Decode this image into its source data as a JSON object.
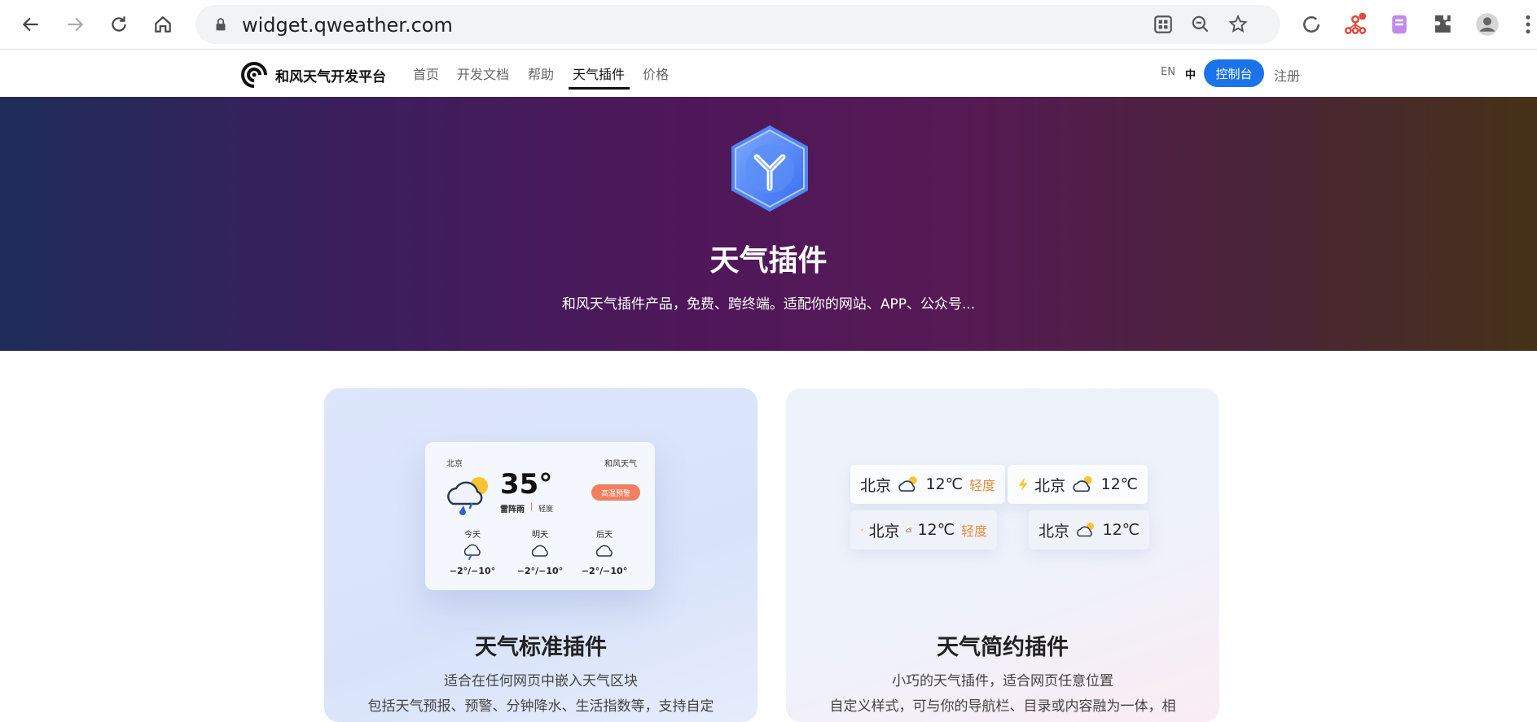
{
  "browser": {
    "url": "widget.qweather.com"
  },
  "site": {
    "brand": "和风天气开发平台",
    "menu": [
      "首页",
      "开发文档",
      "帮助",
      "天气插件",
      "价格"
    ],
    "active_menu": "天气插件",
    "lang_en": "EN",
    "lang_zh": "中",
    "console": "控制台",
    "register": "注册"
  },
  "hero": {
    "title": "天气插件",
    "subtitle": "和风天气插件产品，免费、跨终端。适配你的网站、APP、公众号..."
  },
  "cards": [
    {
      "title": "天气标准插件",
      "desc_lines": [
        "适合在任何网页中嵌入天气区块",
        "包括天气预报、预警、分钟降水、生活指数等，支持自定"
      ],
      "widget": {
        "city": "北京",
        "brand": "和风天气",
        "temp": "35°",
        "condition": "雷阵雨",
        "separator": "|",
        "air": "轻度",
        "alert": "高温预警",
        "forecast": [
          {
            "day": "今天",
            "range": "−2°/−10°",
            "icon": "rain-cloud-icon"
          },
          {
            "day": "明天",
            "range": "−2°/−10°",
            "icon": "cloud-icon"
          },
          {
            "day": "后天",
            "range": "−2°/−10°",
            "icon": "cloud-icon"
          }
        ]
      }
    },
    {
      "title": "天气简约插件",
      "desc_lines": [
        "小巧的天气插件，适合网页任意位置",
        "自定义样式，可与你的导航栏、目录或内容融为一体，相"
      ],
      "widgets": [
        {
          "city": "北京",
          "temp": "12℃",
          "air": "轻度",
          "bolt": false
        },
        {
          "city": "北京",
          "temp": "12℃",
          "air": "",
          "bolt": true
        },
        {
          "city": "北京",
          "temp": "12℃",
          "air": "轻度",
          "bolt": true
        },
        {
          "city": "北京",
          "temp": "12℃",
          "air": "",
          "bolt": false
        }
      ]
    }
  ],
  "colors": {
    "accent": "#1a73e8",
    "air_quality": "#f08a3c",
    "alert": "#f27f5f"
  }
}
